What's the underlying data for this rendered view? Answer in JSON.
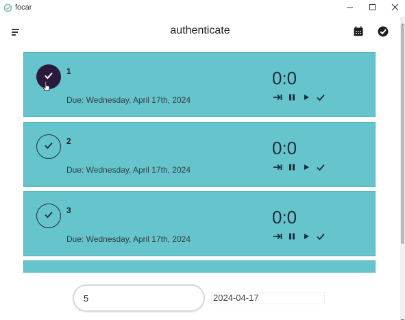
{
  "window": {
    "title": "focar",
    "icons": {
      "app": "app-icon",
      "minimize": "minimize-icon",
      "maximize": "maximize-icon",
      "close": "close-icon"
    }
  },
  "appbar": {
    "title": "authenticate",
    "icons": {
      "menu": "menu-icon",
      "calendar": "calendar-icon",
      "completed": "check-circle-icon"
    }
  },
  "tasks": [
    {
      "number": "1",
      "due": "Due: Wednesday, April 17th, 2024",
      "timer": "0:0",
      "checked": true
    },
    {
      "number": "2",
      "due": "Due: Wednesday, April 17th, 2024",
      "timer": "0:0",
      "checked": false
    },
    {
      "number": "3",
      "due": "Due: Wednesday, April 17th, 2024",
      "timer": "0:0",
      "checked": false
    }
  ],
  "task_actions": [
    "skip-icon",
    "pause-icon",
    "play-icon",
    "check-icon"
  ],
  "form": {
    "task_value": "5",
    "date_value": "2024-04-17"
  },
  "colors": {
    "card": "#66c4cc",
    "checked": "#2a1a3d",
    "text_dark": "#1e2b3c"
  }
}
